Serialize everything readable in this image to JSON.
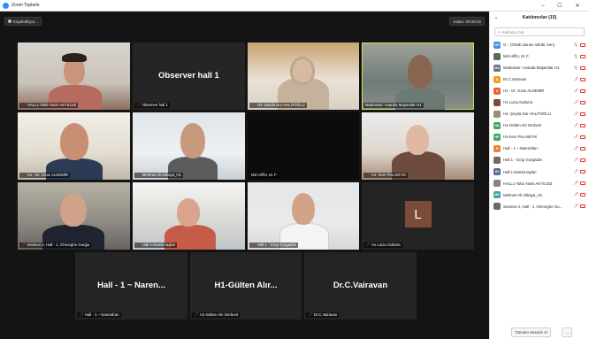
{
  "window": {
    "title": "Zoom Toplantı",
    "minimize": "–",
    "maximize": "☐",
    "close": "✕"
  },
  "meeting": {
    "recording_label": "Kaydediliyor...",
    "timer": "Kalan: 00:28:02"
  },
  "tiles": [
    {
      "name": "HALL1-Taha Yasin AKYILDIZ",
      "muted": true
    },
    {
      "name": "Observer hall 1",
      "muted": true,
      "big_text": "Observer hall 1"
    },
    {
      "name": "H1- Şeyda Nur HALİTOĞLU",
      "muted": true
    },
    {
      "name": "Moderator: Ananda Majumdar H1",
      "muted": false
    },
    {
      "name": "H1 - Dr. Ozan ALDEMİR",
      "muted": true
    },
    {
      "name": "Mehmet Ali Akkaya_H1",
      "muted": true
    },
    {
      "name": "Md Ariffin, M. F.",
      "muted": false
    },
    {
      "name": "H1- İrem PALABIYIK",
      "muted": true
    },
    {
      "name": "Session 2, Hall - 1, Gheorghe Gurgiu",
      "muted": true
    },
    {
      "name": "Hall 1-Damla taşlan",
      "muted": true
    },
    {
      "name": "Hall 1 - Gırgı Gorgadze",
      "muted": true
    },
    {
      "name": "H1 Luiza Galioria",
      "muted": true,
      "avatar": "L"
    },
    {
      "name": "Hall - 1 ~ Narendran",
      "muted": true,
      "big_text": "Hall - 1 ~ Naren..."
    },
    {
      "name": "H1-Gülten Alır Derbent",
      "muted": true,
      "big_text": "H1-Gülten Alır..."
    },
    {
      "name": "Dr.C.Vairavan",
      "muted": true,
      "big_text": "Dr.C.Vairavan"
    }
  ],
  "panel": {
    "title": "Katılımcılar (15)",
    "collapse_icon": "chevron-down-icon",
    "search_placeholder": "Katılımcı bul",
    "participants": [
      {
        "initials": "OH",
        "color": "#4a8fe7",
        "name": "O... (Ortak oturum sahibi, ben)",
        "mic": "on",
        "cam": "off"
      },
      {
        "initials": "",
        "color": "#5b6b4e",
        "name": "Md Ariffin, M. F.",
        "mic": "on",
        "cam": "off",
        "photo": true
      },
      {
        "initials": "MA",
        "color": "#6b6f80",
        "name": "Moderator: Ananda Majumdar H1",
        "mic": "on",
        "cam": "off"
      },
      {
        "initials": "D",
        "color": "#f0a020",
        "name": "Dr.C.Vairavan",
        "mic": "off",
        "cam": "off"
      },
      {
        "initials": "H",
        "color": "#e86040",
        "name": "H1 - Dr. Ozan ALDEMİR",
        "mic": "off",
        "cam": "off"
      },
      {
        "initials": "",
        "color": "#7a4b38",
        "name": "H1 Luiza Galioria",
        "mic": "off",
        "cam": "off",
        "photo": true
      },
      {
        "initials": "",
        "color": "#9a8a7a",
        "name": "H1- Şeyda Nur HALİTOĞLU",
        "mic": "off",
        "cam": "off",
        "photo": true
      },
      {
        "initials": "HA",
        "color": "#3aa860",
        "name": "H1-Gülten Alır Derbent",
        "mic": "off",
        "cam": "off"
      },
      {
        "initials": "HP",
        "color": "#3aa860",
        "name": "H1-İrem PALABIYIK",
        "mic": "off",
        "cam": "off"
      },
      {
        "initials": "H",
        "color": "#f08030",
        "name": "Hall - 1 ~ Narendran",
        "mic": "off",
        "cam": "off"
      },
      {
        "initials": "",
        "color": "#6f6a64",
        "name": "Hall 1 - Gırgı Gorgadze",
        "mic": "off",
        "cam": "off",
        "photo": true
      },
      {
        "initials": "H1",
        "color": "#5a6a90",
        "name": "Hall 1-Damla taşlan",
        "mic": "off",
        "cam": "off"
      },
      {
        "initials": "",
        "color": "#8b8178",
        "name": "HALL1-Taha Yasin AKYILDIZ",
        "mic": "off",
        "cam": "off",
        "photo": true
      },
      {
        "initials": "MA",
        "color": "#3aa8a0",
        "name": "Mehmet Ali Akkaya_H1",
        "mic": "off",
        "cam": "off"
      },
      {
        "initials": "",
        "color": "#6a6a6a",
        "name": "Session-2, Hall - 1, Gheorghe Gu...",
        "mic": "off",
        "cam": "off",
        "photo": true
      }
    ],
    "mute_all_label": "Tümünü Sessize Al",
    "more_label": "..."
  }
}
